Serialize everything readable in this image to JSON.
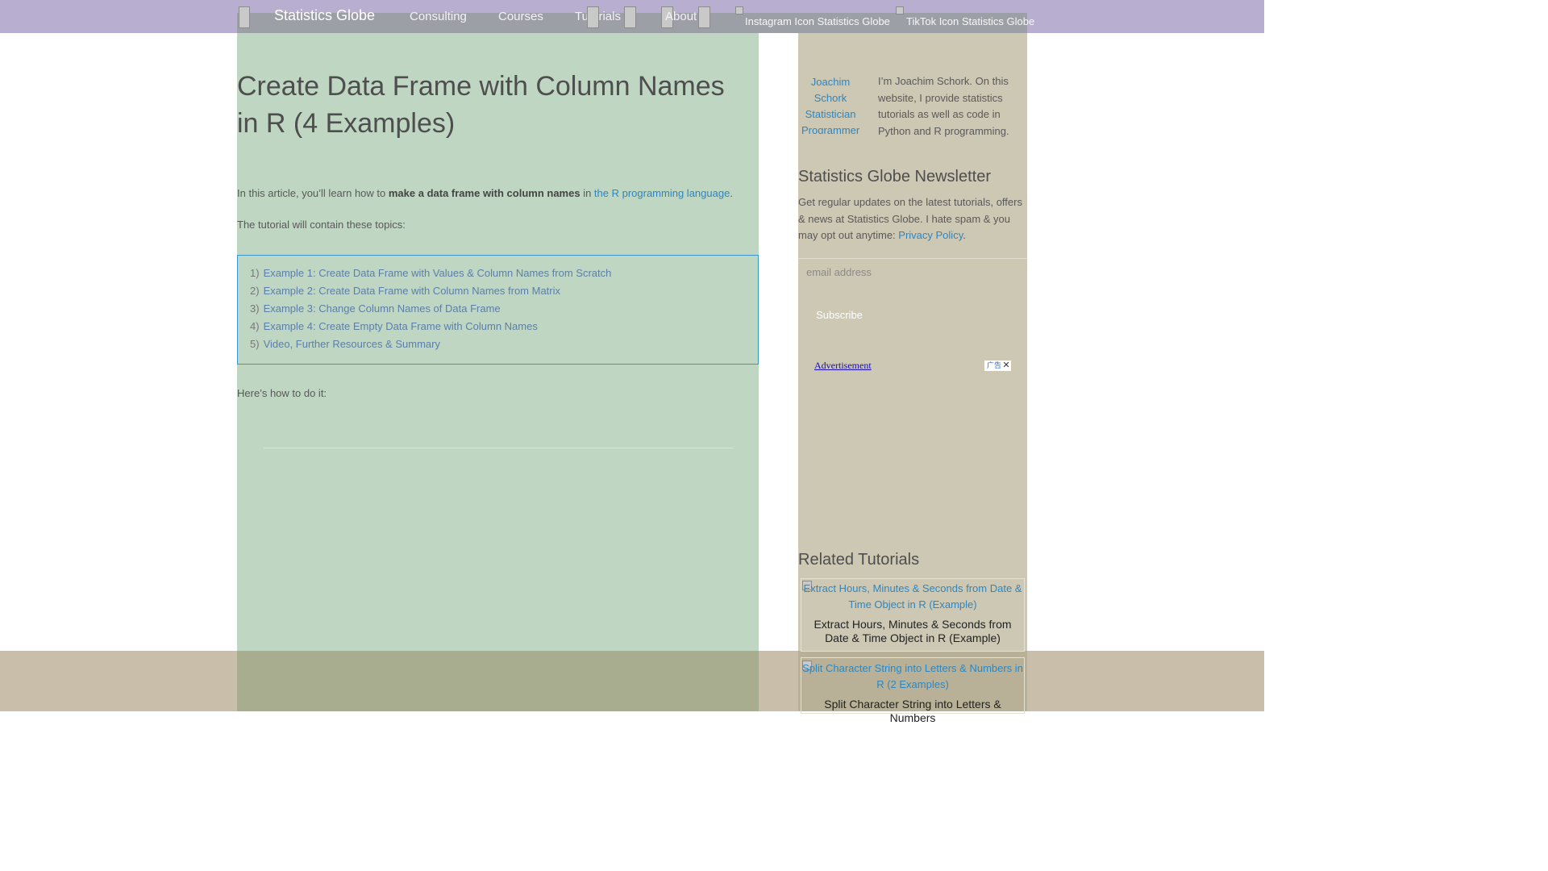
{
  "nav": {
    "brand": "Statistics Globe",
    "links": [
      "Consulting",
      "Courses",
      "Tutorials",
      "About"
    ],
    "social": {
      "instagram_alt": "Instagram Icon Statistics Globe",
      "tiktok_alt": "TikTok Icon Statistics Globe"
    }
  },
  "article": {
    "title": "Create Data Frame with Column Names in R (4 Examples)",
    "intro_before": "In this article, you’ll learn how to ",
    "intro_bold": "make a data frame with column names",
    "intro_middle": " in ",
    "intro_link": "the R programming language",
    "intro_after": ".",
    "topics_intro": "The tutorial will contain these topics:",
    "toc": [
      {
        "num": "1)",
        "label": "Example 1: Create Data Frame with Values & Column Names from Scratch"
      },
      {
        "num": "2)",
        "label": "Example 2: Create Data Frame with Column Names from Matrix"
      },
      {
        "num": "3)",
        "label": "Example 3: Change Column Names of Data Frame"
      },
      {
        "num": "4)",
        "label": "Example 4: Create Empty Data Frame with Column Names"
      },
      {
        "num": "5)",
        "label": "Video, Further Resources & Summary"
      }
    ],
    "howto": "Here’s how to do it:"
  },
  "sidebar": {
    "author_img_alt": "Joachim Schork Statistician Programmer",
    "author_text": "I’m Joachim Schork. On this website, I provide statistics tutorials as well as code in Python and R programming.",
    "newsletter_title": "Statistics Globe Newsletter",
    "newsletter_text": "Get regular updates on the latest tutorials, offers & news at Statistics Globe. I hate spam & you may opt out anytime: ",
    "privacy_link": "Privacy Policy",
    "privacy_after": ".",
    "email_placeholder": "email address",
    "subscribe_label": "Subscribe",
    "ad_label": "Advertisement",
    "ad_badge": "广告",
    "ad_close": "✕",
    "related_title": "Related Tutorials",
    "related": [
      {
        "img_alt": "Extract Hours, Minutes & Seconds from Date & Time Object in R (Example)",
        "title": "Extract Hours, Minutes & Seconds from Date & Time Object in R (Example)"
      },
      {
        "img_alt": "Split Character String into Letters & Numbers in R (2 Examples)",
        "title": "Split Character String into Letters & Numbers"
      }
    ]
  },
  "colors": {
    "nav_bg": "#b7aed0",
    "main_bg": "#bfd6c3",
    "sidebar_bg": "#cdc8b4",
    "link": "#2e86c1",
    "toc_border": "#3b95cf"
  }
}
